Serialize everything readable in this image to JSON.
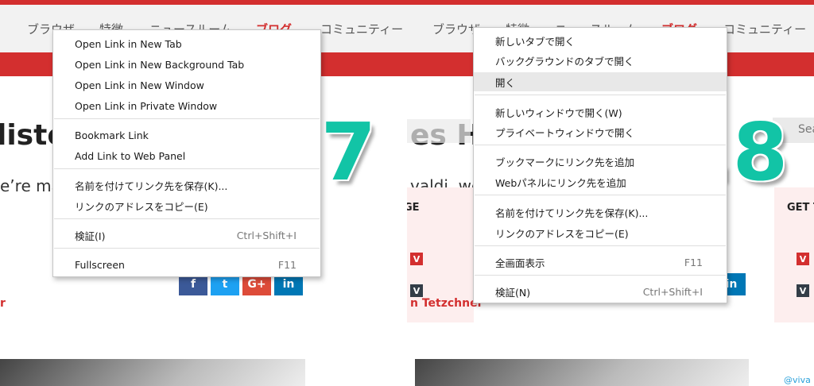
{
  "left": {
    "nav": [
      "ブラウザ",
      "特徴",
      "ニュースルーム",
      "ブログ",
      "コミュニティー"
    ],
    "headline": "listo",
    "lede": "e’re mal",
    "byline": "r",
    "version": "1.7",
    "menu": {
      "items": [
        {
          "label": "Open Link in New Tab"
        },
        {
          "label": "Open Link in New Background Tab"
        },
        {
          "label": "Open Link in New Window"
        },
        {
          "label": "Open Link in Private Window"
        },
        {
          "label": "Bookmark Link"
        },
        {
          "label": "Add Link to Web Panel"
        },
        {
          "label": "名前を付けてリンク先を保存(K)..."
        },
        {
          "label": "リンクのアドレスをコピー(E)"
        },
        {
          "label": "検証(I)",
          "shortcut": "Ctrl+Shift+I"
        },
        {
          "label": "Fullscreen",
          "shortcut": "F11"
        }
      ]
    },
    "social": [
      "f",
      "t",
      "G+",
      "in"
    ]
  },
  "right": {
    "nav": [
      "ブラウザ",
      "特徴",
      "ニュースルーム",
      "ブログ",
      "コミュニティー"
    ],
    "headline": "es H",
    "lede": "valdi, we",
    "get_label_left": "GE",
    "get_label_right": "GET T",
    "byline": "n Tetzchner",
    "search": "Sea",
    "twitter": "@viva",
    "version": "1.8",
    "social_in": "in",
    "menu": {
      "items": [
        {
          "label": "新しいタブで開く"
        },
        {
          "label": "バックグラウンドのタブで開く"
        },
        {
          "label": "開く"
        },
        {
          "label": "新しいウィンドウで開く(W)"
        },
        {
          "label": "プライベートウィンドウで開く"
        },
        {
          "label": "ブックマークにリンク先を追加"
        },
        {
          "label": "Webパネルにリンク先を追加"
        },
        {
          "label": "名前を付けてリンク先を保存(K)..."
        },
        {
          "label": "リンクのアドレスをコピー(E)"
        },
        {
          "label": "全画面表示",
          "shortcut": "F11"
        },
        {
          "label": "検証(N)",
          "shortcut": "Ctrl+Shift+I"
        }
      ]
    }
  },
  "colors": {
    "brand_red": "#d32f2f",
    "version_teal": "#12c4a6",
    "facebook": "#3b5998",
    "twitter": "#1da1f2",
    "gplus": "#dd4b39",
    "linkedin": "#0077b5"
  }
}
